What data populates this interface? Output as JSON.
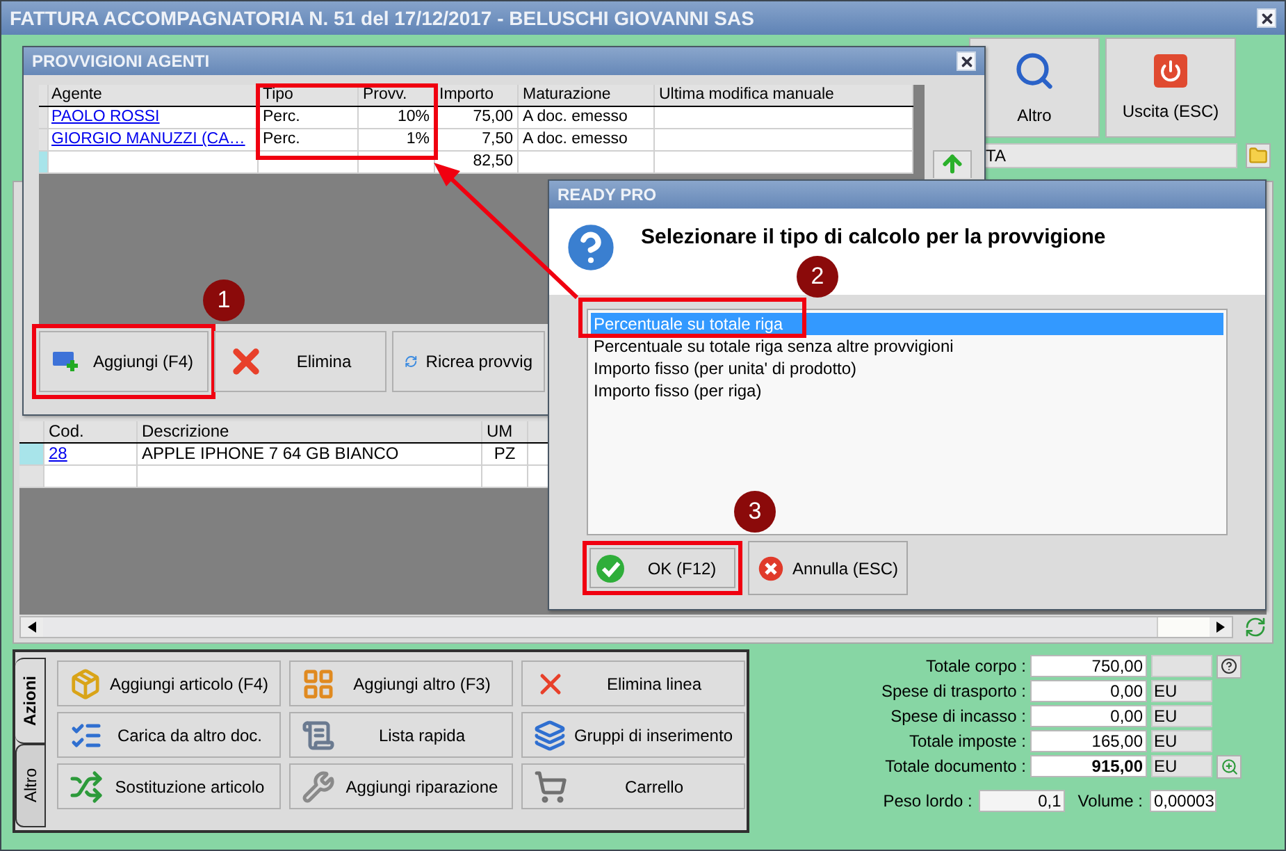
{
  "window": {
    "title": "FATTURA ACCOMPAGNATORIA N. 51 del 17/12/2017 - BELUSCHI GIOVANNI SAS"
  },
  "toolbar": [
    {
      "label": "Altro",
      "kind": "search"
    },
    {
      "label": "Uscita (ESC)",
      "kind": "exit"
    }
  ],
  "customer_field": {
    "value": "TA"
  },
  "articles": {
    "columns": [
      "Cod.",
      "Descrizione",
      "UM"
    ],
    "rows": [
      {
        "code": "28",
        "description": "APPLE IPHONE 7 64 GB BIANCO",
        "unit": "PZ",
        "selected": true
      }
    ]
  },
  "action_tabs": [
    {
      "label": "Azioni",
      "selected": true
    },
    {
      "label": "Altro",
      "selected": false
    }
  ],
  "actions": [
    {
      "label": "Aggiungi articolo (F4)",
      "kind": "add-item"
    },
    {
      "label": "Aggiungi altro (F3)",
      "kind": "add-other"
    },
    {
      "label": "Elimina linea",
      "kind": "delete"
    },
    {
      "label": "Carica da altro doc.",
      "kind": "load"
    },
    {
      "label": "Lista rapida",
      "kind": "list"
    },
    {
      "label": "Gruppi di inserimento",
      "kind": "groups"
    },
    {
      "label": "Sostituzione articolo",
      "kind": "swap"
    },
    {
      "label": "Aggiungi riparazione",
      "kind": "repair"
    },
    {
      "label": "Carrello",
      "kind": "cart"
    }
  ],
  "totals": [
    {
      "label": "Totale corpo :",
      "value": "750,00",
      "kind": "help",
      "bold": false
    },
    {
      "label": "Spese di trasporto :",
      "value": "0,00",
      "unit": "EU",
      "kind": "plain",
      "bold": false
    },
    {
      "label": "Spese di incasso :",
      "value": "0,00",
      "unit": "EU",
      "kind": "plain",
      "bold": false
    },
    {
      "label": "Totale imposte :",
      "value": "165,00",
      "unit": "EU",
      "kind": "plain",
      "bold": false
    },
    {
      "label": "Totale documento :",
      "value": "915,00",
      "unit": "EU",
      "kind": "zoom",
      "bold": true
    }
  ],
  "weights": [
    {
      "label": "Peso lordo :",
      "value": "0,1"
    },
    {
      "label": "Volume :",
      "value": "0,00003"
    }
  ],
  "provvigioni": {
    "title": "PROVVIGIONI AGENTI",
    "columns": [
      "Agente",
      "Tipo",
      "Provv.",
      "Importo",
      "Maturazione",
      "Ultima modifica manuale"
    ],
    "rows": [
      {
        "agent": "PAOLO ROSSI",
        "type": "Perc.",
        "rate": "10%",
        "amount": "75,00",
        "accrual": "A doc. emesso"
      },
      {
        "agent": "GIORGIO MANUZZI (CA…",
        "type": "Perc.",
        "rate": "1%",
        "amount": "7,50",
        "accrual": "A doc. emesso"
      }
    ],
    "total": "82,50",
    "buttons": [
      {
        "label": "Aggiungi (F4)",
        "kind": "add",
        "highlighted": true
      },
      {
        "label": "Elimina",
        "kind": "delete",
        "highlighted": false
      },
      {
        "label": "Ricrea provvig",
        "kind": "refresh",
        "highlighted": false
      }
    ]
  },
  "dialog": {
    "title": "READY PRO",
    "question": "Selezionare il tipo di calcolo per la provvigione",
    "options": [
      {
        "label": "Percentuale su totale riga",
        "selected": true
      },
      {
        "label": "Percentuale su totale riga senza altre provvigioni",
        "selected": false
      },
      {
        "label": "Importo fisso (per unita' di prodotto)",
        "selected": false
      },
      {
        "label": "Importo fisso (per riga)",
        "selected": false
      }
    ],
    "buttons": [
      {
        "label": "OK (F12)",
        "kind": "ok",
        "highlighted": true
      },
      {
        "label": "Annulla (ESC)",
        "kind": "cancel",
        "highlighted": false
      }
    ]
  },
  "annotations": [
    {
      "label": "1"
    },
    {
      "label": "2"
    },
    {
      "label": "3"
    }
  ]
}
